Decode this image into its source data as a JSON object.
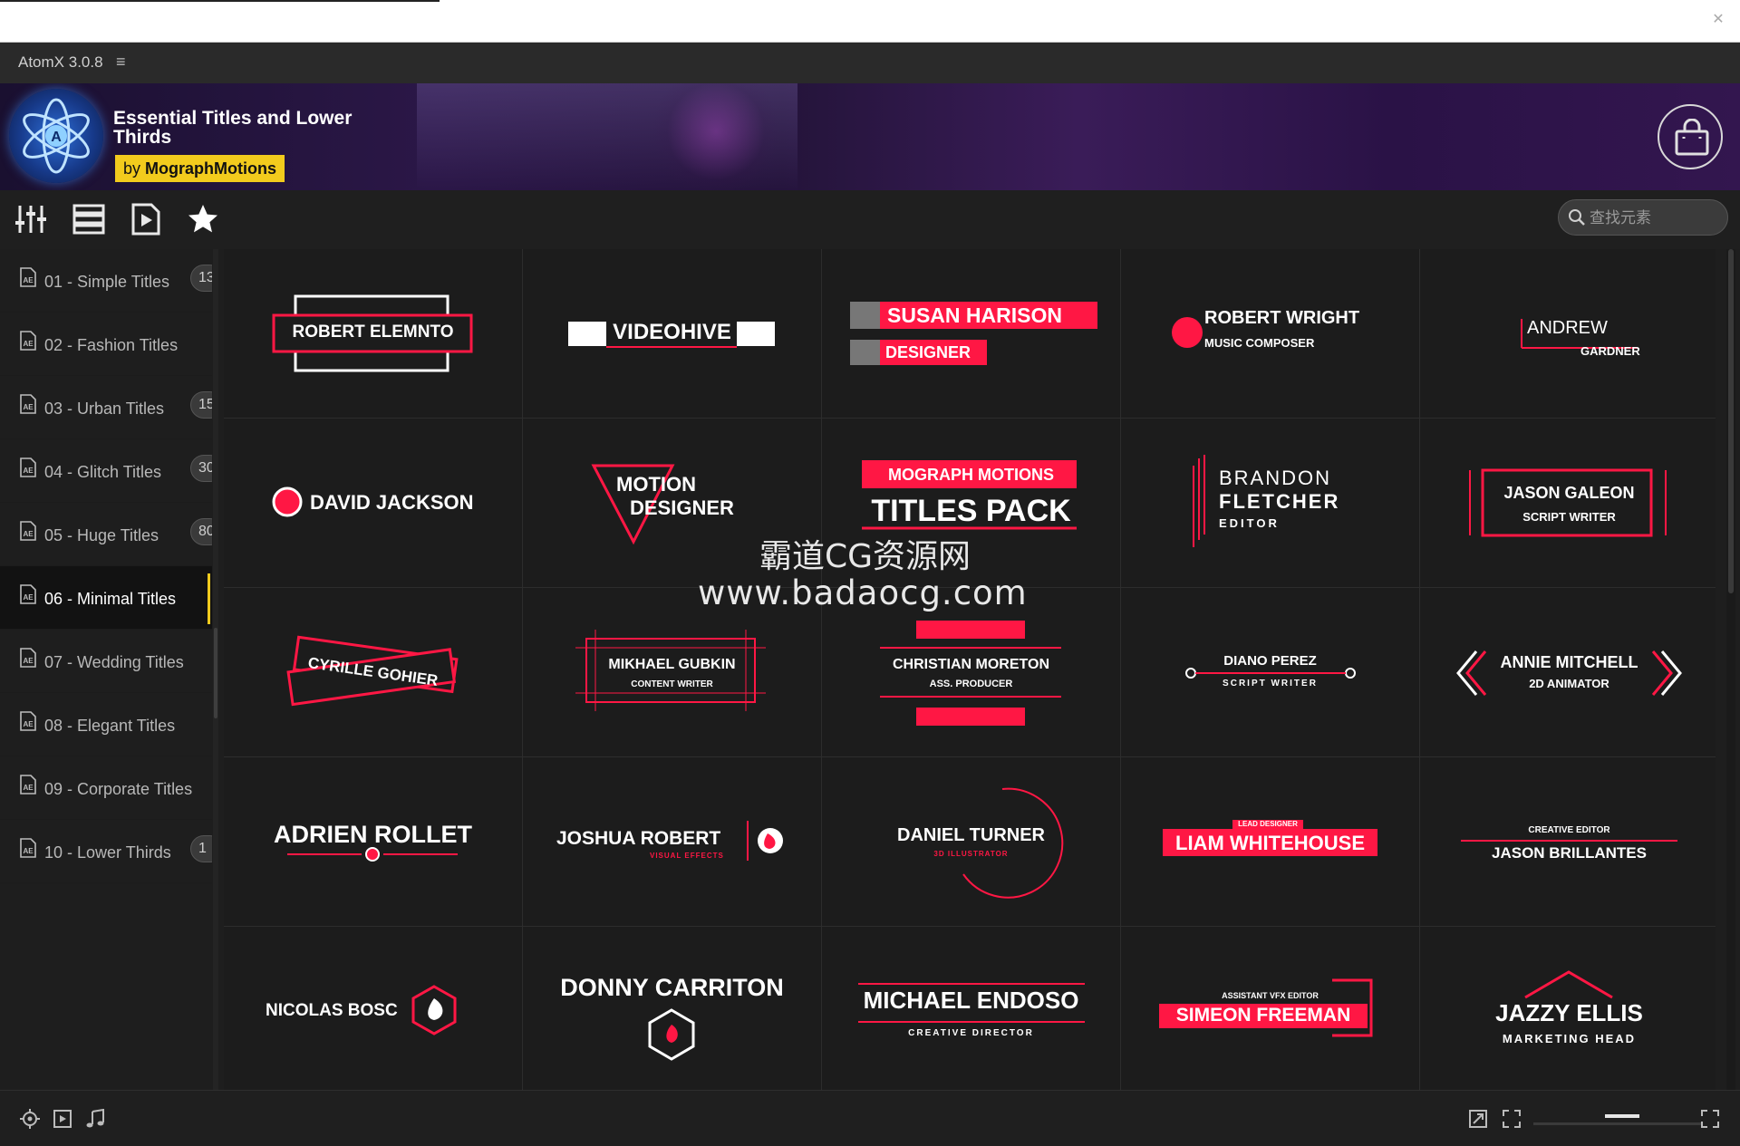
{
  "app": {
    "title": "AtomX 3.0.8"
  },
  "pack": {
    "title": "Essential Titles and Lower Thirds",
    "author_prefix": "by",
    "author": "MographMotions"
  },
  "search": {
    "placeholder": "查找元素"
  },
  "categories": [
    {
      "label": "01 - Simple Titles",
      "count": "13"
    },
    {
      "label": "02 - Fashion Titles",
      "count": ""
    },
    {
      "label": "03 - Urban Titles",
      "count": "15"
    },
    {
      "label": "04 - Glitch Titles",
      "count": "30"
    },
    {
      "label": "05 - Huge Titles",
      "count": "80"
    },
    {
      "label": "06 - Minimal Titles",
      "count": "",
      "active": true
    },
    {
      "label": "07 - Wedding Titles",
      "count": ""
    },
    {
      "label": "08 - Elegant Titles",
      "count": ""
    },
    {
      "label": "09 - Corporate Titles",
      "count": ""
    },
    {
      "label": "10 - Lower Thirds",
      "count": "1"
    }
  ],
  "tiles": {
    "r1c1": {
      "name": "ROBERT ELEMNTO"
    },
    "r1c2": {
      "name": "VIDEOHIVE"
    },
    "r1c3": {
      "name": "SUSAN HARISON",
      "role": "DESIGNER"
    },
    "r1c4": {
      "name": "ROBERT WRIGHT",
      "role": "MUSIC COMPOSER"
    },
    "r1c5": {
      "first": "ANDREW",
      "last": "GARDNER"
    },
    "r2c1": {
      "name": "DAVID JACKSON"
    },
    "r2c2": {
      "line1": "MOTION",
      "line2": "DESIGNER"
    },
    "r2c3": {
      "line1": "MOGRAPH MOTIONS",
      "line2": "TITLES PACK"
    },
    "r2c4": {
      "first": "BRANDON",
      "last": "FLETCHER",
      "role": "EDITOR"
    },
    "r2c5": {
      "name": "JASON GALEON",
      "role": "SCRIPT WRITER"
    },
    "r3c1": {
      "name": "CYRILLE GOHIER"
    },
    "r3c2": {
      "name": "MIKHAEL GUBKIN",
      "role": "CONTENT WRITER"
    },
    "r3c3": {
      "name": "CHRISTIAN MORETON",
      "role": "ASS. PRODUCER"
    },
    "r3c4": {
      "name": "DIANO PEREZ",
      "role": "SCRIPT WRITER"
    },
    "r3c5": {
      "name": "ANNIE MITCHELL",
      "role": "2D ANIMATOR"
    },
    "r4c1": {
      "name": "ADRIEN ROLLET"
    },
    "r4c2": {
      "name": "JOSHUA ROBERT",
      "role": "VISUAL EFFECTS"
    },
    "r4c3": {
      "name": "DANIEL TURNER",
      "role": "3D ILLUSTRATOR"
    },
    "r4c4": {
      "role": "LEAD DESIGNER",
      "name": "LIAM WHITEHOUSE"
    },
    "r4c5": {
      "role": "CREATIVE EDITOR",
      "name": "JASON BRILLANTES"
    },
    "r5c1": {
      "name": "NICOLAS BOSC"
    },
    "r5c2": {
      "name": "DONNY CARRITON"
    },
    "r5c3": {
      "name": "MICHAEL ENDOSO",
      "role": "CREATIVE DIRECTOR"
    },
    "r5c4": {
      "role": "ASSISTANT VFX EDITOR",
      "name": "SIMEON FREEMAN"
    },
    "r5c5": {
      "name": "JAZZY ELLIS",
      "role": "MARKETING HEAD"
    }
  },
  "watermark": {
    "line1": "霸道CG资源网",
    "line2": "www.badaocg.com"
  },
  "colors": {
    "accent": "#ff1744",
    "badge": "#f2cb1d",
    "tile_bg": "#1c1c1c"
  },
  "icons": {
    "toolbar": [
      "mixer-sliders-icon",
      "list-view-icon",
      "play-file-icon",
      "favorites-star-icon"
    ],
    "statusbar": [
      "target-icon",
      "video-icon",
      "music-note-icon",
      "expand-icon",
      "fullscreen-icon",
      "grid-size-icon"
    ]
  }
}
